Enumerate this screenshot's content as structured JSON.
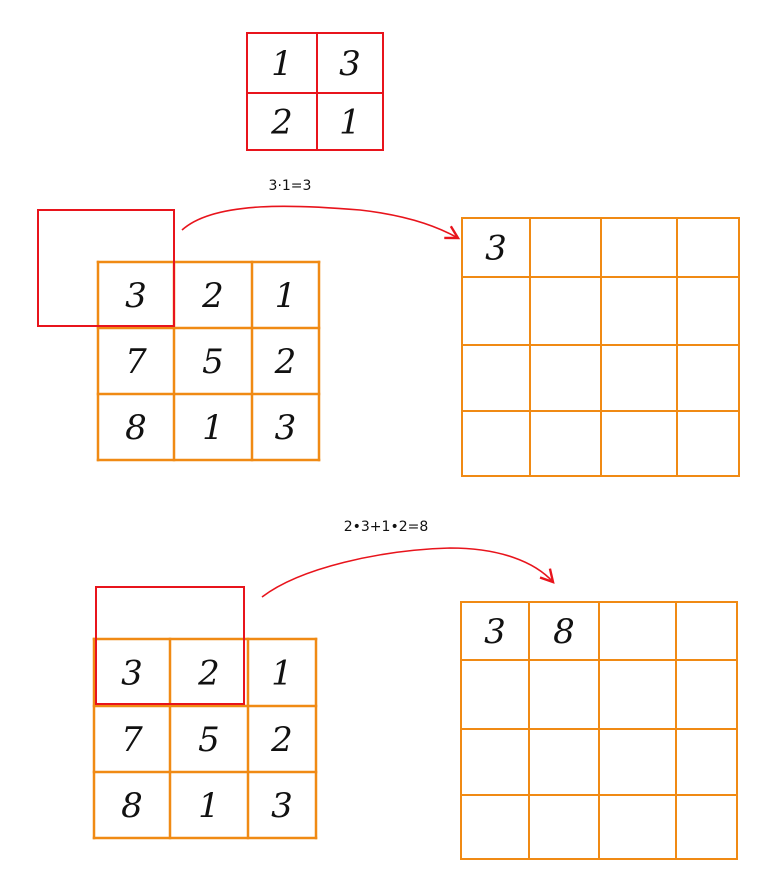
{
  "colors": {
    "kernel": "#e8141c",
    "grid": "#f08a14",
    "arrow": "#e8141c",
    "text": "#111111"
  },
  "kernel": {
    "values": [
      [
        "1",
        "3"
      ],
      [
        "2",
        "1"
      ]
    ]
  },
  "input": {
    "values": [
      [
        "3",
        "2",
        "1"
      ],
      [
        "7",
        "5",
        "2"
      ],
      [
        "8",
        "1",
        "3"
      ]
    ]
  },
  "step1": {
    "formula": "3·1=3",
    "output": [
      [
        "3",
        "",
        "",
        ""
      ],
      [
        "",
        "",
        "",
        ""
      ],
      [
        "",
        "",
        "",
        ""
      ],
      [
        "",
        "",
        "",
        ""
      ]
    ]
  },
  "step2": {
    "formula": "2•3+1•2=8",
    "output": [
      [
        "3",
        "8",
        "",
        ""
      ],
      [
        "",
        "",
        "",
        ""
      ],
      [
        "",
        "",
        "",
        ""
      ],
      [
        "",
        "",
        "",
        ""
      ]
    ]
  }
}
